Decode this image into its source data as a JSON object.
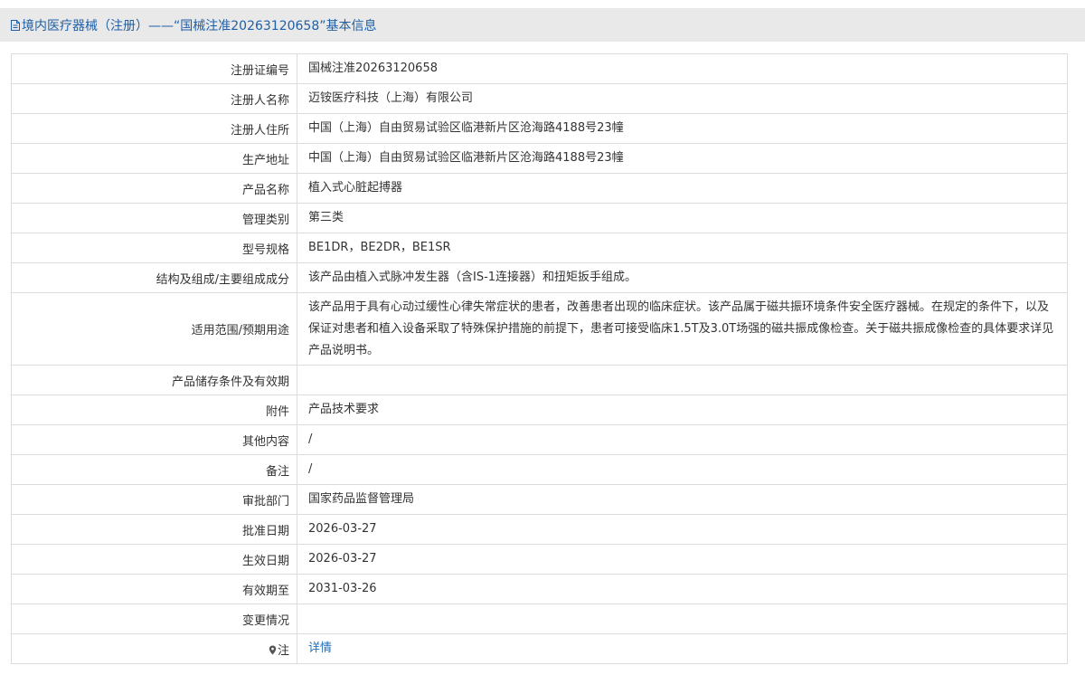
{
  "header": {
    "title": "境内医疗器械（注册）——“国械注准20263120658”基本信息",
    "icon": "document-icon"
  },
  "rows": [
    {
      "label": "注册证编号",
      "value": "国械注准20263120658"
    },
    {
      "label": "注册人名称",
      "value": "迈铵医疗科技（上海）有限公司"
    },
    {
      "label": "注册人住所",
      "value": "中国（上海）自由贸易试验区临港新片区沧海路4188号23幢"
    },
    {
      "label": "生产地址",
      "value": "中国（上海）自由贸易试验区临港新片区沧海路4188号23幢"
    },
    {
      "label": "产品名称",
      "value": "植入式心脏起搏器"
    },
    {
      "label": "管理类别",
      "value": "第三类"
    },
    {
      "label": "型号规格",
      "value": "BE1DR，BE2DR，BE1SR"
    },
    {
      "label": "结构及组成/主要组成成分",
      "value": "该产品由植入式脉冲发生器（含IS-1连接器）和扭矩扳手组成。"
    },
    {
      "label": "适用范围/预期用途",
      "value": "该产品用于具有心动过缓性心律失常症状的患者，改善患者出现的临床症状。该产品属于磁共振环境条件安全医疗器械。在规定的条件下，以及保证对患者和植入设备采取了特殊保护措施的前提下，患者可接受临床1.5T及3.0T场强的磁共振成像检查。关于磁共振成像检查的具体要求详见产品说明书。"
    },
    {
      "label": "产品储存条件及有效期",
      "value": ""
    },
    {
      "label": "附件",
      "value": "产品技术要求"
    },
    {
      "label": "其他内容",
      "value": "/"
    },
    {
      "label": "备注",
      "value": "/"
    },
    {
      "label": "审批部门",
      "value": "国家药品监督管理局"
    },
    {
      "label": "批准日期",
      "value": "2026-03-27"
    },
    {
      "label": "生效日期",
      "value": "2026-03-27"
    },
    {
      "label": "有效期至",
      "value": "2031-03-26"
    },
    {
      "label": "变更情况",
      "value": ""
    }
  ],
  "note_row": {
    "label": "注",
    "icon": "location-pin-icon",
    "link_text": "详情"
  },
  "colors": {
    "header_bg": "#e9e9e9",
    "title": "#1e5fa8",
    "link": "#1e6fb8",
    "border": "#dcdcdc"
  }
}
